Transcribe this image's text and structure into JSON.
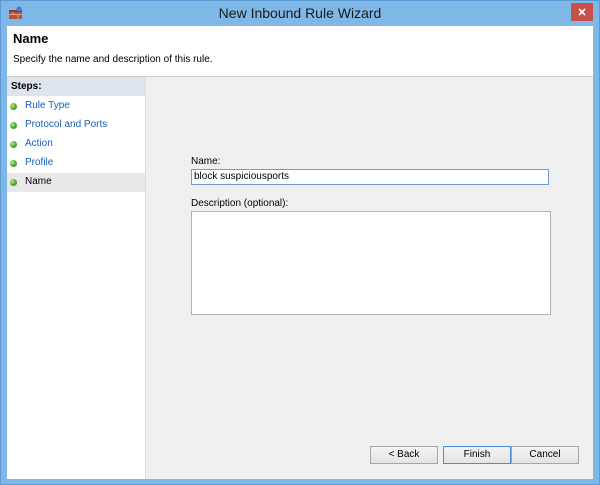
{
  "window": {
    "title": "New Inbound Rule Wizard",
    "accent": "#7fb7e6",
    "close_color": "#c7504a"
  },
  "header": {
    "title": "Name",
    "subtitle": "Specify the name and description of this rule."
  },
  "steps": {
    "heading": "Steps:",
    "items": [
      {
        "label": "Rule Type",
        "selected": false
      },
      {
        "label": "Protocol and Ports",
        "selected": false
      },
      {
        "label": "Action",
        "selected": false
      },
      {
        "label": "Profile",
        "selected": false
      },
      {
        "label": "Name",
        "selected": true
      }
    ]
  },
  "form": {
    "name_label": "Name:",
    "name_value": "block suspiciousports",
    "description_label": "Description (optional):",
    "description_value": ""
  },
  "buttons": {
    "back": "< Back",
    "finish": "Finish",
    "cancel": "Cancel"
  }
}
